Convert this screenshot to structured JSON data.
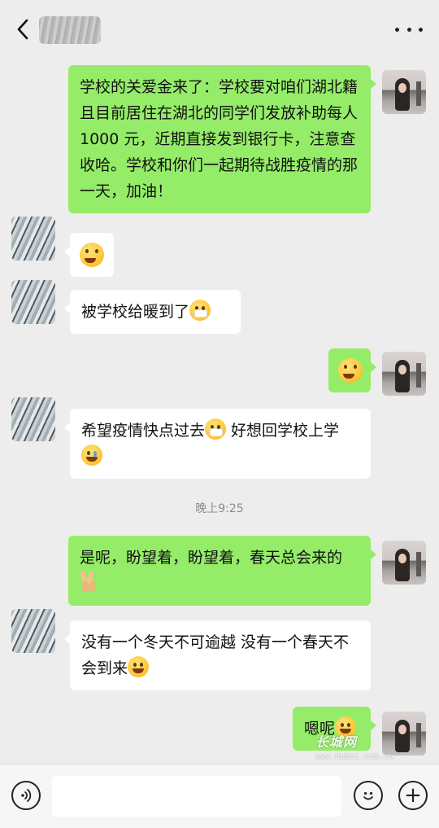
{
  "header": {
    "back_icon": "chevron-left-icon",
    "more_icon": "more-dots-icon"
  },
  "messages": [
    {
      "side": "right",
      "type": "text",
      "text": "学校的关爱金来了：学校要对咱们湖北籍且目前居住在湖北的同学们发放补助每人 1000 元，近期直接发到银行卡，注意查收哈。学校和你们一起期待战胜疫情的那一天，加油！"
    },
    {
      "side": "left",
      "type": "emoji",
      "emoji": "flushed-emoji"
    },
    {
      "side": "left",
      "type": "text",
      "text": "被学校给暖到了",
      "emoji": "mask-emoji"
    },
    {
      "side": "right",
      "type": "emoji",
      "emoji": "grin-emoji"
    },
    {
      "side": "left",
      "type": "text",
      "text_a": "希望疫情快点过去",
      "text_b": " 好想回学校上学",
      "emoji_a": "mask-emoji",
      "emoji_b": "crying-emoji"
    },
    {
      "side": "right",
      "type": "text",
      "text": "是呢，盼望着，盼望着，春天总会来的",
      "emoji": "victory-hand-emoji"
    },
    {
      "side": "left",
      "type": "text",
      "text": "没有一个冬天不可逾越 没有一个春天不会到来",
      "emoji": "shush-emoji"
    },
    {
      "side": "right",
      "type": "text",
      "text": "嗯呢",
      "emoji": "flushed-emoji"
    }
  ],
  "timestamp": "晚上9:25",
  "bottom_bar": {
    "voice_icon": "voice-icon",
    "emoji_icon": "emoji-icon",
    "plus_icon": "plus-icon",
    "plus_glyph": "+"
  },
  "watermark": {
    "logo": "长城网",
    "url": "www.hebei.com.cn"
  }
}
